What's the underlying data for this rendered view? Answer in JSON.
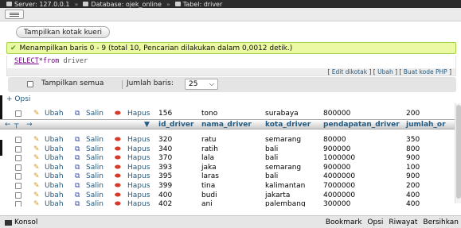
{
  "breadcrumb": {
    "server": "Server: 127.0.0.1",
    "database": "Database: ojek_online",
    "table": "Tabel: driver"
  },
  "toolbar": {
    "query_box_label": "Tampilkan kotak kueri"
  },
  "message": {
    "text": "Menampilkan baris 0 - 9 (total 10, Pencarian dilakukan dalam 0,0012 detik.)"
  },
  "sql": {
    "select": "SELECT",
    "star": "*",
    "from": "from",
    "table": "driver"
  },
  "sql_links": {
    "edit_inline": "Edit dikotak",
    "edit": "Ubah",
    "create_php": "Buat kode PHP"
  },
  "nav": {
    "show_all": "Tampilkan semua",
    "rows_label": "Jumlah baris:",
    "rows_value": "25"
  },
  "options_link": "+ Opsi",
  "actions": {
    "edit": "Ubah",
    "copy": "Salin",
    "delete": "Hapus"
  },
  "columns": [
    "id_driver",
    "nama_driver",
    "kota_driver",
    "pendapatan_driver",
    "jumlah_or"
  ],
  "top_row": {
    "id": "156",
    "name": "tono",
    "city": "surabaya",
    "income": "800000",
    "count": "200"
  },
  "rows": [
    {
      "id": "320",
      "name": "ratu",
      "city": "semarang",
      "income": "80000",
      "count": "350"
    },
    {
      "id": "340",
      "name": "ratih",
      "city": "bali",
      "income": "900000",
      "count": "800"
    },
    {
      "id": "370",
      "name": "lala",
      "city": "bali",
      "income": "1000000",
      "count": "900"
    },
    {
      "id": "393",
      "name": "jaka",
      "city": "semarang",
      "income": "900000",
      "count": "100"
    },
    {
      "id": "395",
      "name": "laras",
      "city": "bali",
      "income": "4000000",
      "count": "900"
    },
    {
      "id": "399",
      "name": "tina",
      "city": "kalimantan",
      "income": "7000000",
      "count": "200"
    },
    {
      "id": "400",
      "name": "budi",
      "city": "jakarta",
      "income": "4000000",
      "count": "400"
    },
    {
      "id": "402",
      "name": "ani",
      "city": "palembang",
      "income": "300000",
      "count": "400"
    }
  ],
  "console": {
    "label": "Konsol",
    "bookmark": "Bookmark",
    "options": "Opsi",
    "history": "Riwayat",
    "clear": "Bersihkan"
  },
  "colors": {
    "success_bg": "#ebf8a4",
    "link": "#235a81",
    "delete": "#d63a2a"
  }
}
